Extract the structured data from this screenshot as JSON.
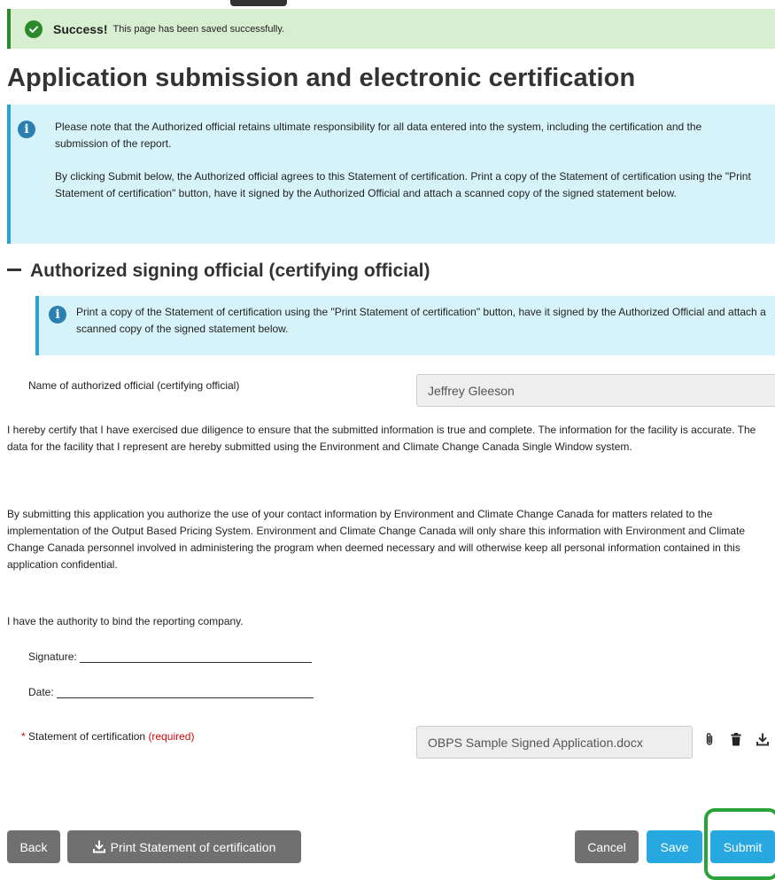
{
  "alert": {
    "title": "Success!",
    "message": "This page has been saved successfully."
  },
  "page_title": "Application submission and electronic certification",
  "intro_notice": {
    "p1": "Please note that the Authorized official retains ultimate responsibility for all data entered into the system, including the certification and the submission of the report.",
    "p2": "By clicking Submit below, the Authorized official agrees to this Statement of certification. Print a copy of the Statement of certification using the \"Print Statement of certification\" button, have it signed by the Authorized Official and attach a scanned copy of the signed statement below."
  },
  "section": {
    "title": "Authorized signing official (certifying official)",
    "notice": "Print a copy of the Statement of certification using the \"Print Statement of certification\" button, have it signed by the Authorized Official and attach a scanned copy of the signed statement below.",
    "official_label": "Name of authorized official (certifying official)",
    "official_value": "Jeffrey Gleeson",
    "cert_text": "I hereby certify that I have exercised due diligence to ensure that the submitted information is true and complete.  The information for the facility is accurate. The data for the facility that I represent are hereby submitted using the Environment and Climate Change Canada Single Window system.",
    "auth_text": "By submitting this application you authorize the use of your contact information by Environment and Climate Change Canada for matters related to the implementation of the Output Based Pricing System. Environment and Climate Change Canada will only share this information with Environment and Climate Change Canada personnel involved in administering the program when deemed necessary and will otherwise keep all personal information contained in this application confidential.",
    "bind_text": "I have the authority to bind the reporting company.",
    "signature_label": "Signature:",
    "date_label": "Date:",
    "statement_star": "*",
    "statement_label": "Statement of certification",
    "statement_required": "(required)",
    "statement_file": "OBPS Sample Signed Application.docx"
  },
  "icons": {
    "success": "check-circle-icon",
    "info": "info-circle-icon",
    "attach": "paperclip-icon",
    "delete": "trash-icon",
    "download": "download-icon"
  },
  "buttons": {
    "back": "Back",
    "print": "Print Statement of certification",
    "cancel": "Cancel",
    "save": "Save",
    "submit": "Submit"
  },
  "colors": {
    "success_bg": "#d8eed0",
    "success_accent": "#2b8a2b",
    "info_bg": "#d7f3fa",
    "info_accent": "#2aa5c9",
    "primary": "#28a8e0",
    "secondary": "#707070",
    "required": "#d3080c",
    "highlight": "#2aa43a"
  }
}
